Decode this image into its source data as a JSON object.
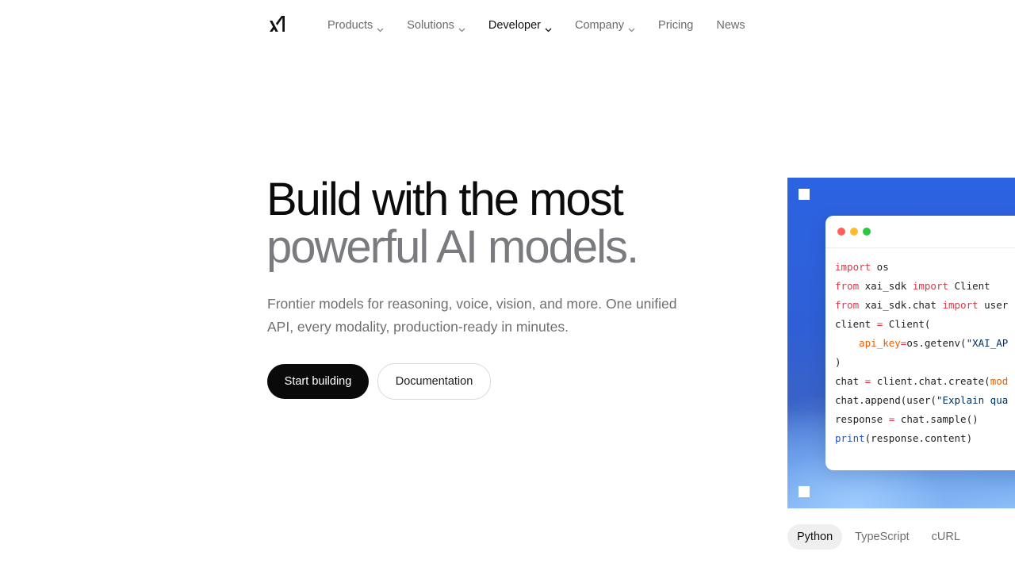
{
  "nav": {
    "logo_icon": "xai-logo-icon",
    "items": [
      {
        "label": "Products",
        "has_dropdown": true,
        "active": false
      },
      {
        "label": "Solutions",
        "has_dropdown": true,
        "active": false
      },
      {
        "label": "Developer",
        "has_dropdown": true,
        "active": true
      },
      {
        "label": "Company",
        "has_dropdown": true,
        "active": false
      },
      {
        "label": "Pricing",
        "has_dropdown": false,
        "active": false
      },
      {
        "label": "News",
        "has_dropdown": false,
        "active": false
      }
    ]
  },
  "hero": {
    "title_line1": "Build with the most",
    "title_line2": "powerful AI models.",
    "subtitle": "Frontier models for reasoning, voice, vision, and more. One unified API, every modality, production-ready in minutes.",
    "primary_button": "Start building",
    "secondary_button": "Documentation"
  },
  "code_window": {
    "lines": [
      [
        {
          "t": "import",
          "c": "kw"
        },
        {
          "t": " os",
          "c": ""
        }
      ],
      [
        {
          "t": "from",
          "c": "kw"
        },
        {
          "t": " xai_sdk ",
          "c": ""
        },
        {
          "t": "import",
          "c": "kw"
        },
        {
          "t": " Client",
          "c": ""
        }
      ],
      [
        {
          "t": "from",
          "c": "kw"
        },
        {
          "t": " xai_sdk.chat ",
          "c": ""
        },
        {
          "t": "import",
          "c": "kw"
        },
        {
          "t": " user",
          "c": ""
        }
      ],
      [
        {
          "t": "client ",
          "c": ""
        },
        {
          "t": "=",
          "c": "op"
        },
        {
          "t": " Client(",
          "c": ""
        }
      ],
      [
        {
          "t": "    ",
          "c": ""
        },
        {
          "t": "api_key",
          "c": "arg"
        },
        {
          "t": "=",
          "c": "op"
        },
        {
          "t": "os.getenv(",
          "c": ""
        },
        {
          "t": "\"XAI_AP",
          "c": "str"
        }
      ],
      [
        {
          "t": ")",
          "c": ""
        }
      ],
      [
        {
          "t": "chat ",
          "c": ""
        },
        {
          "t": "=",
          "c": "op"
        },
        {
          "t": " client.chat.create(",
          "c": ""
        },
        {
          "t": "mod",
          "c": "arg"
        }
      ],
      [
        {
          "t": "chat.append(user(",
          "c": ""
        },
        {
          "t": "\"Explain qua",
          "c": "str"
        }
      ],
      [
        {
          "t": "response ",
          "c": ""
        },
        {
          "t": "=",
          "c": "op"
        },
        {
          "t": " chat.sample()",
          "c": ""
        }
      ],
      [
        {
          "t": "print",
          "c": "fn"
        },
        {
          "t": "(response.content)",
          "c": ""
        }
      ]
    ]
  },
  "tabs": [
    {
      "label": "Python",
      "active": true
    },
    {
      "label": "TypeScript",
      "active": false
    },
    {
      "label": "cURL",
      "active": false
    }
  ],
  "colors": {
    "primary_button_bg": "#0a0a0a",
    "accent_blue": "#2c63e2"
  }
}
